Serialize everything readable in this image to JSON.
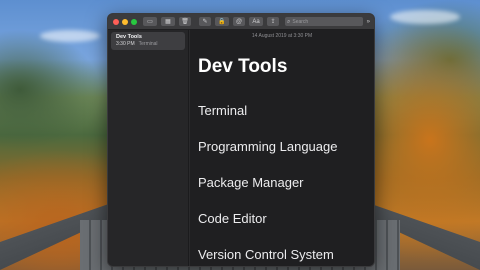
{
  "toolbar": {
    "buttons": [
      {
        "name": "toggle-sidebar-icon",
        "glyph": "▭"
      },
      {
        "name": "gallery-view-icon",
        "glyph": "▦"
      },
      {
        "name": "trash-icon",
        "glyph": "🗑"
      },
      {
        "name": "compose-icon",
        "glyph": "✎"
      },
      {
        "name": "lock-icon",
        "glyph": "🔒"
      },
      {
        "name": "at-icon",
        "glyph": "@"
      },
      {
        "name": "text-format-icon",
        "glyph": "Aa"
      },
      {
        "name": "share-icon",
        "glyph": "⇪"
      }
    ],
    "search": {
      "placeholder": "Search",
      "icon": "search-icon",
      "glyph": "⌕"
    },
    "more_glyph": "»"
  },
  "traffic_lights": {
    "close": "#ff5f57",
    "minimize": "#febc2e",
    "zoom": "#28c840"
  },
  "sidebar": {
    "notes": [
      {
        "title": "Dev Tools",
        "time": "3:30 PM",
        "preview": "Terminal"
      }
    ]
  },
  "editor": {
    "date": "14 August 2019 at 3:30 PM",
    "title": "Dev Tools",
    "lines": [
      "Terminal",
      "Programming Language",
      "Package Manager",
      "Code Editor",
      "Version Control System"
    ]
  }
}
